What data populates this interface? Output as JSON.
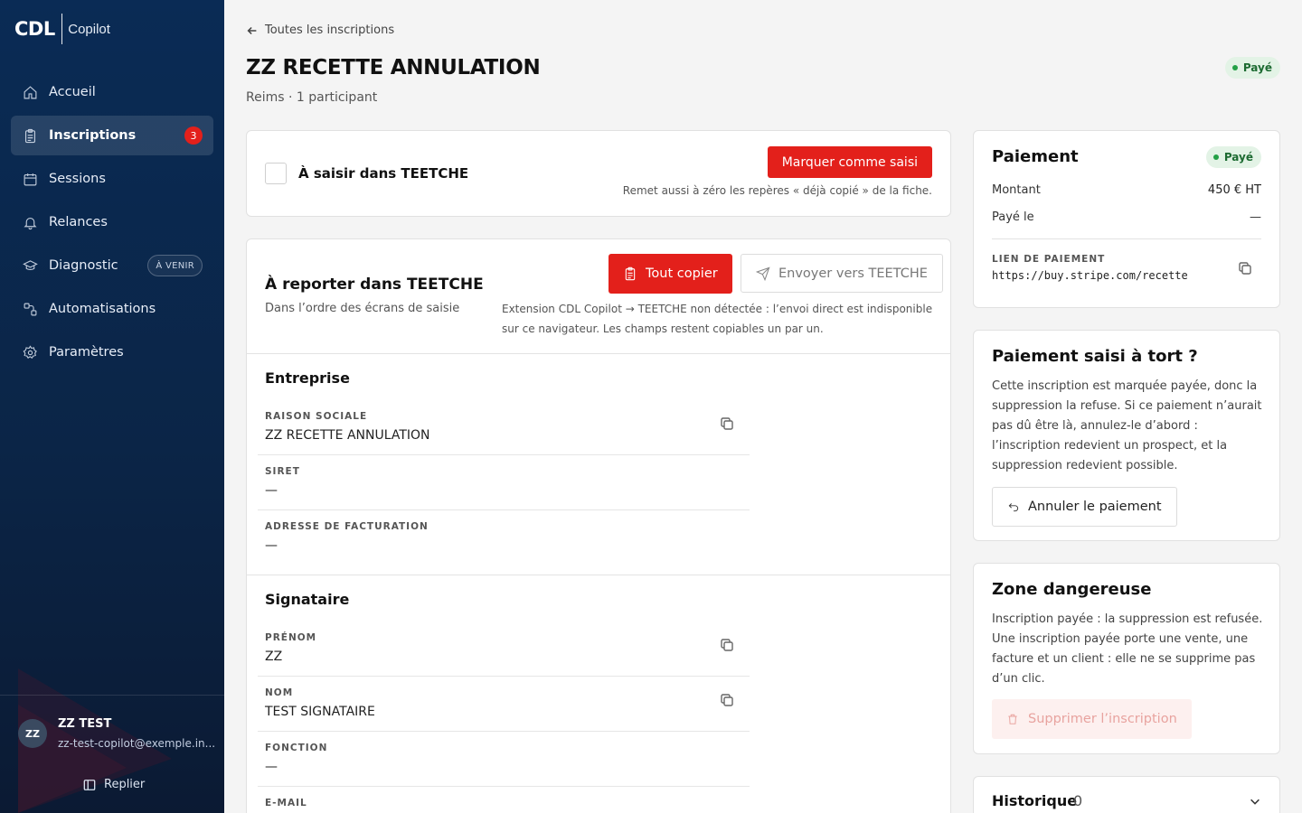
{
  "brand": {
    "name": "CDL",
    "product": "Copilot"
  },
  "nav": {
    "items": [
      {
        "label": "Accueil"
      },
      {
        "label": "Inscriptions",
        "badge": "3"
      },
      {
        "label": "Sessions"
      },
      {
        "label": "Relances"
      },
      {
        "label": "Diagnostic",
        "tag": "À VENIR"
      },
      {
        "label": "Automatisations"
      },
      {
        "label": "Paramètres"
      }
    ]
  },
  "user": {
    "initials": "ZZ",
    "name": "ZZ TEST",
    "email": "zz-test-copilot@exemple.in...",
    "collapse_label": "Replier"
  },
  "header": {
    "back_label": "Toutes les inscriptions",
    "title": "ZZ RECETTE ANNULATION",
    "subtitle": "Reims · 1 participant",
    "status": "Payé"
  },
  "entry_card": {
    "label": "À saisir dans TEETCHE",
    "button": "Marquer comme saisi",
    "hint": "Remet aussi à zéro les repères « déjà copié » de la fiche."
  },
  "report_card": {
    "title": "À reporter dans TEETCHE",
    "subtitle": "Dans l’ordre des écrans de saisie",
    "copy_all": "Tout copier",
    "send": "Envoyer vers TEETCHE",
    "notice": "Extension CDL Copilot → TEETCHE non détectée : l’envoi direct est indisponible sur ce navigateur. Les champs restent copiables un par un.",
    "sections": [
      {
        "title": "Entreprise",
        "fields": [
          {
            "label": "RAISON SOCIALE",
            "value": "ZZ RECETTE ANNULATION",
            "copy": true
          },
          {
            "label": "SIRET",
            "value": "—"
          },
          {
            "label": "ADRESSE DE FACTURATION",
            "value": "—"
          }
        ]
      },
      {
        "title": "Signataire",
        "fields": [
          {
            "label": "PRÉNOM",
            "value": "ZZ",
            "copy": true
          },
          {
            "label": "NOM",
            "value": "TEST SIGNATAIRE",
            "copy": true
          },
          {
            "label": "FONCTION",
            "value": "—"
          },
          {
            "label": "E-MAIL",
            "value": ""
          }
        ]
      }
    ]
  },
  "payment": {
    "title": "Paiement",
    "status": "Payé",
    "amount_label": "Montant",
    "amount_value": "450 € HT",
    "paid_on_label": "Payé le",
    "paid_on_value": "—",
    "link_label": "LIEN DE PAIEMENT",
    "link_value": "https://buy.stripe.com/recette"
  },
  "wrong_payment": {
    "title": "Paiement saisi à tort ?",
    "text": "Cette inscription est marquée payée, donc la suppression la refuse. Si ce paiement n’aurait pas dû être là, annulez-le d’abord : l’inscription redevient un prospect, et la suppression redevient possible.",
    "button": "Annuler le paiement"
  },
  "danger": {
    "title": "Zone dangereuse",
    "text": "Inscription payée : la suppression est refusée. Une inscription payée porte une vente, une facture et un client : elle ne se supprime pas d’un clic.",
    "button": "Supprimer l’inscription"
  },
  "history": {
    "title": "Historique",
    "count": "0"
  },
  "colors": {
    "accent": "#e3201b",
    "sidebar": "#0a2b55",
    "success": "#23a046"
  }
}
